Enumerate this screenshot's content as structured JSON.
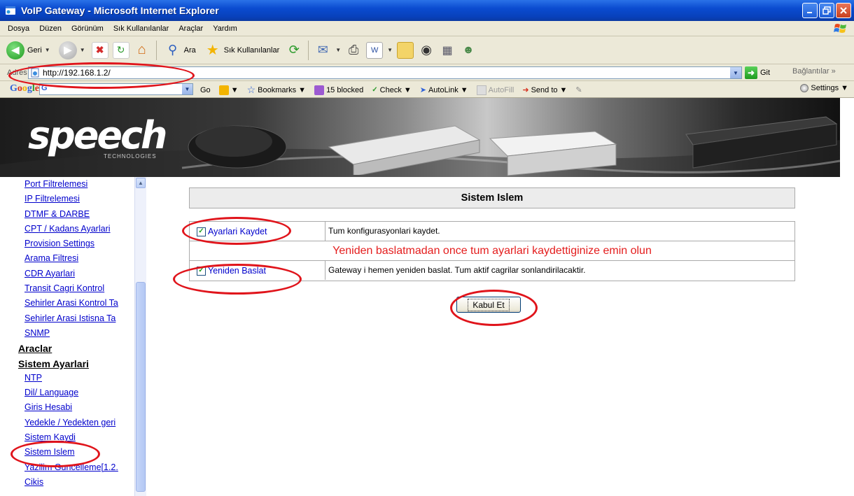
{
  "window": {
    "title": "VoIP Gateway - Microsoft Internet Explorer"
  },
  "menu": [
    "Dosya",
    "Düzen",
    "Görünüm",
    "Sık Kullanılanlar",
    "Araçlar",
    "Yardım"
  ],
  "toolbar": {
    "back": "Geri",
    "search": "Ara",
    "favorites": "Sık Kullanılanlar"
  },
  "address": {
    "label": "Adres",
    "url": "http://192.168.1.2/",
    "go": "Git",
    "links": "Bağlantılar"
  },
  "google": {
    "logo": "Google",
    "field": "G",
    "go": "Go",
    "bookmarks": "Bookmarks",
    "blocked": "15 blocked",
    "check": "Check",
    "autolink": "AutoLink",
    "autofill": "AutoFill",
    "sendto": "Send to",
    "settings": "Settings"
  },
  "banner": {
    "logo": "speech",
    "sub": "TECHNOLOGIES"
  },
  "sidebar": {
    "items": [
      {
        "label": "Port Filtrelemesi",
        "type": "link"
      },
      {
        "label": "IP Filtrelemesi",
        "type": "link"
      },
      {
        "label": "DTMF & DARBE",
        "type": "link"
      },
      {
        "label": "CPT / Kadans Ayarlari",
        "type": "link"
      },
      {
        "label": "Provision Settings",
        "type": "link"
      },
      {
        "label": "Arama Filtresi",
        "type": "link"
      },
      {
        "label": "CDR Ayarlari",
        "type": "link"
      },
      {
        "label": "Transit Cagri Kontrol",
        "type": "link"
      },
      {
        "label": "Sehirler Arasi Kontrol Ta",
        "type": "link"
      },
      {
        "label": "Sehirler Arasi Istisna Ta",
        "type": "link"
      },
      {
        "label": "SNMP",
        "type": "link"
      },
      {
        "label": "Araclar",
        "type": "head"
      },
      {
        "label": "Sistem Ayarlari",
        "type": "head"
      },
      {
        "label": "NTP",
        "type": "link"
      },
      {
        "label": "Dil/ Language",
        "type": "link"
      },
      {
        "label": "Giris Hesabi",
        "type": "link"
      },
      {
        "label": "Yedekle / Yedekten geri",
        "type": "link"
      },
      {
        "label": "Sistem Kaydi",
        "type": "link"
      },
      {
        "label": "Sistem Islem",
        "type": "link"
      },
      {
        "label": "Yazilim Guncelleme[1.2.",
        "type": "link"
      },
      {
        "label": "Cikis",
        "type": "link"
      }
    ]
  },
  "main": {
    "title": "Sistem Islem",
    "save": {
      "label": "Ayarlari Kaydet",
      "desc": "Tum konfigurasyonlari kaydet.",
      "checked": true
    },
    "warning": "Yeniden baslatmadan once tum ayarlari kaydettiginize emin olun",
    "restart": {
      "label": "Yeniden Baslat",
      "desc": "Gateway i hemen yeniden baslat. Tum aktif cagrilar sonlandirilacaktir.",
      "checked": true
    },
    "submit": "Kabul Et"
  },
  "colors": {
    "link": "#0000cc",
    "warning": "#e41d1d",
    "annotation": "#e0141b",
    "titlebar": "#0a4bd0"
  }
}
